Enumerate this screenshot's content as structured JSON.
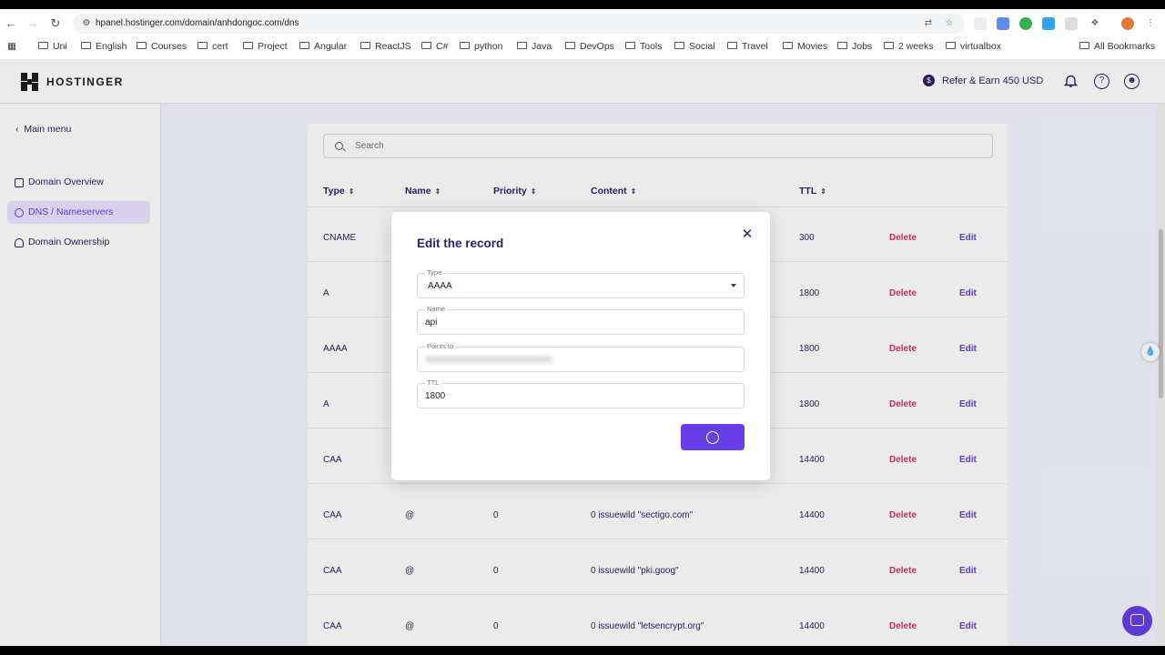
{
  "browser": {
    "url": "hpanel.hostinger.com/domain/anhdongoc.com/dns",
    "bookmarks": [
      "Uni",
      "English",
      "Courses",
      "cert",
      "Project",
      "Angular",
      "ReactJS",
      "C#",
      "python",
      "Java",
      "DevOps",
      "Tools",
      "Social",
      "Travel",
      "Movies",
      "Jobs",
      "2 weeks",
      "virtualbox"
    ],
    "all_bookmarks": "All Bookmarks"
  },
  "header": {
    "logo_text": "HOSTINGER",
    "refer": "Refer & Earn 450 USD"
  },
  "sidebar": {
    "back": "Main menu",
    "items": [
      {
        "label": "Domain Overview",
        "active": false
      },
      {
        "label": "DNS / Nameservers",
        "active": true
      },
      {
        "label": "Domain Ownership",
        "active": false
      }
    ]
  },
  "table": {
    "search_placeholder": "Search",
    "headers": [
      "Type",
      "Name",
      "Priority",
      "Content",
      "TTL"
    ],
    "rows": [
      {
        "type": "CNAME",
        "name": "",
        "priority": "",
        "content": "",
        "ttl": "300"
      },
      {
        "type": "A",
        "name": "",
        "priority": "",
        "content": "",
        "ttl": "1800"
      },
      {
        "type": "AAAA",
        "name": "",
        "priority": "",
        "content": "",
        "ttl": "1800"
      },
      {
        "type": "A",
        "name": "",
        "priority": "",
        "content": "",
        "ttl": "1800"
      },
      {
        "type": "CAA",
        "name": "",
        "priority": "",
        "content": "",
        "ttl": "14400"
      },
      {
        "type": "CAA",
        "name": "@",
        "priority": "0",
        "content": "0 issuewild \"sectigo.com\"",
        "ttl": "14400"
      },
      {
        "type": "CAA",
        "name": "@",
        "priority": "0",
        "content": "0 issuewild \"pki.goog\"",
        "ttl": "14400"
      },
      {
        "type": "CAA",
        "name": "@",
        "priority": "0",
        "content": "0 issuewild \"letsencrypt.org\"",
        "ttl": "14400"
      }
    ],
    "delete_label": "Delete",
    "edit_label": "Edit"
  },
  "modal": {
    "title": "Edit the record",
    "type_label": "Type",
    "type_value": "AAAA",
    "name_label": "Name",
    "name_value": "api",
    "points_label": "Points to",
    "ttl_label": "TTL",
    "ttl_value": "1800"
  },
  "colors": {
    "accent": "#673de6",
    "delete": "#d63163",
    "text": "#2f1c6a"
  }
}
